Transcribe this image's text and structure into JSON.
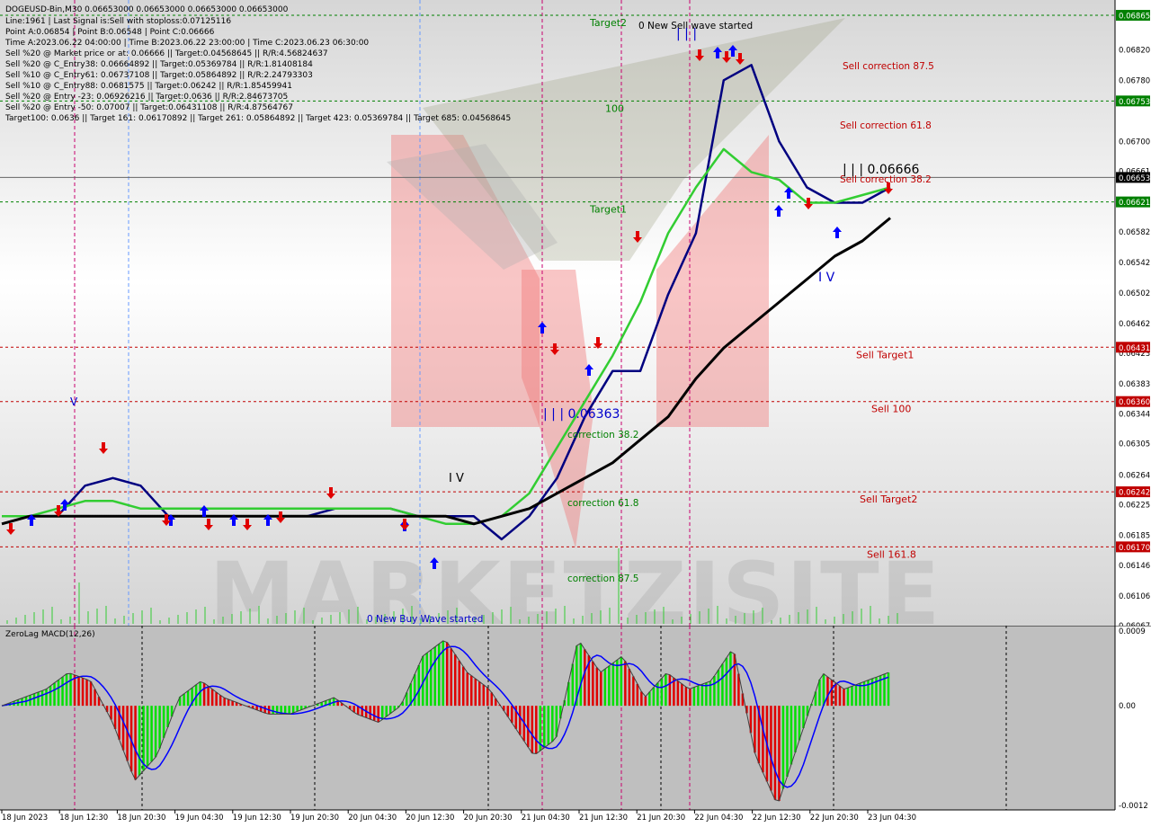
{
  "header": {
    "symbol_line": "DOGEUSD-Bin,M30  0.06653000 0.06653000 0.06653000 0.06653000",
    "info_lines": [
      "Line:1961 | Last Signal is:Sell with stoploss:0.07125116",
      "Point A:0.06854 | Point B:0.06548 | Point C:0.06666",
      "Time A:2023.06.22 04:00:00 | Time B:2023.06.22 23:00:00 | Time C:2023.06.23 06:30:00",
      "Sell %20 @ Market price or at: 0.06666 || Target:0.04568645 || R/R:4.56824637",
      "Sell %20 @ C_Entry38: 0.06664892 || Target:0.05369784 || R/R:1.81408184",
      "Sell %10 @ C_Entry61: 0.06737108 || Target:0.05864892 || R/R:2.24793303",
      "Sell %10 @ C_Entry88: 0.0681575 || Target:0.06242 || R/R:1.85459941",
      "Sell %20 @ Entry -23: 0.06926216 || Target:0.0636 || R/R:2.84673705",
      "Sell %20 @ Entry -50: 0.07007 || Target:0.06431108 || R/R:4.87564767",
      "Target100: 0.0636 || Target 161: 0.06170892 || Target 261: 0.05864892 || Target 423: 0.05369784 || Target 685: 0.04568645"
    ]
  },
  "colors": {
    "target_level": "#008000",
    "sell_level": "#c00000",
    "fast_ma": "#000080",
    "mid_ma": "#32cd32",
    "slow_ma": "#000000",
    "macd_up": "#00e000",
    "macd_down": "#e00000",
    "signal_line": "#0000ff",
    "buy_arrow": "#0000ff",
    "sell_arrow": "#e00000",
    "current_price": "#000000",
    "cycle_line": "#c8006e"
  },
  "price_axis": {
    "ticks": [
      "0.06820",
      "0.06780",
      "0.06700",
      "0.06661",
      "0.06621",
      "0.06582",
      "0.06542",
      "0.06502",
      "0.06462",
      "0.06423",
      "0.06383",
      "0.06344",
      "0.06305",
      "0.06264",
      "0.06225",
      "0.06185",
      "0.06146",
      "0.06106",
      "0.06067"
    ],
    "highlight_labels": [
      {
        "value": 0.06865,
        "text": "0.06865",
        "color": "#008000"
      },
      {
        "value": 0.06753,
        "text": "0.06753",
        "color": "#008000"
      },
      {
        "value": 0.06621,
        "text": "0.06621",
        "color": "#008000"
      },
      {
        "value": 0.06653,
        "text": "0.06653",
        "color": "#000000"
      },
      {
        "value": 0.06431,
        "text": "0.06431",
        "color": "#c00000"
      },
      {
        "value": 0.0636,
        "text": "0.06360",
        "color": "#c00000"
      },
      {
        "value": 0.06242,
        "text": "0.06242",
        "color": "#c00000"
      },
      {
        "value": 0.0617,
        "text": "0.06170",
        "color": "#c00000"
      }
    ]
  },
  "time_axis": {
    "labels": [
      "18 Jun 2023",
      "18 Jun 12:30",
      "18 Jun 20:30",
      "19 Jun 04:30",
      "19 Jun 12:30",
      "19 Jun 20:30",
      "20 Jun 04:30",
      "20 Jun 12:30",
      "20 Jun 20:30",
      "21 Jun 04:30",
      "21 Jun 12:30",
      "21 Jun 20:30",
      "22 Jun 04:30",
      "22 Jun 12:30",
      "22 Jun 20:30",
      "23 Jun 04:30"
    ]
  },
  "levels": [
    {
      "value": 0.06865,
      "label": "Target2",
      "label_color": "#008000"
    },
    {
      "value": 0.06753,
      "label": "100",
      "label_color": "#008000"
    },
    {
      "value": 0.06621,
      "label": "Target1",
      "label_color": "#008000"
    },
    {
      "value": 0.06431,
      "label": "Sell Target1",
      "label_color": "#c00000"
    },
    {
      "value": 0.0636,
      "label": "Sell 100",
      "label_color": "#c00000"
    },
    {
      "value": 0.06242,
      "label": "Sell Target2",
      "label_color": "#c00000"
    },
    {
      "value": 0.0617,
      "label": "Sell 161.8",
      "label_color": "#c00000"
    }
  ],
  "annotations": {
    "sell_wave": "0 New Sell wave started",
    "buy_wave": "0 New Buy Wave started",
    "sell_corrections": [
      "Sell correction 87.5",
      "Sell correction 61.8",
      "Sell correction 38.2"
    ],
    "buy_corrections": [
      "correction 38.2",
      "correction 61.8",
      "correction 87.5"
    ],
    "point_c_label": "| | | 0.06666",
    "point_b_label": "| | | 0.06363",
    "wave_marks": [
      "| | |",
      "I V",
      "I V",
      "V"
    ]
  },
  "watermark": "MARKETZISITE",
  "macd": {
    "title": "ZeroLag MACD(12,26)",
    "axis_labels": [
      "0.0009",
      "0.00",
      "-0.0012"
    ]
  },
  "chart_data": {
    "type": "line",
    "title": "DOGEUSD-Bin,M30",
    "y_axis_range": [
      0.06067,
      0.06885
    ],
    "current_price": 0.06653,
    "series": [
      {
        "values": [
          0.0621,
          0.0621,
          0.0621,
          0.0625,
          0.0626,
          0.0625,
          0.0621,
          0.0621,
          0.0621,
          0.0621,
          0.0621,
          0.0621,
          0.0622,
          0.0622,
          0.0622,
          0.0621,
          0.0621,
          0.0621,
          0.0618,
          0.0621,
          0.0626,
          0.0634,
          0.064,
          0.064,
          0.065,
          0.0658,
          0.0678,
          0.068,
          0.067,
          0.0664,
          0.0662,
          0.0662,
          0.0664
        ]
      },
      {
        "values": [
          0.0621,
          0.0621,
          0.0622,
          0.0623,
          0.0623,
          0.0622,
          0.0622,
          0.0622,
          0.0622,
          0.0622,
          0.0622,
          0.0622,
          0.0622,
          0.0622,
          0.0622,
          0.0621,
          0.062,
          0.062,
          0.0621,
          0.0624,
          0.063,
          0.0636,
          0.0642,
          0.0649,
          0.0658,
          0.0664,
          0.0669,
          0.0666,
          0.0665,
          0.0662,
          0.0662,
          0.0663,
          0.0664
        ]
      },
      {
        "values": [
          0.062,
          0.0621,
          0.0621,
          0.0621,
          0.0621,
          0.0621,
          0.0621,
          0.0621,
          0.0621,
          0.0621,
          0.0621,
          0.0621,
          0.0621,
          0.0621,
          0.0621,
          0.0621,
          0.0621,
          0.062,
          0.0621,
          0.0622,
          0.0624,
          0.0626,
          0.0628,
          0.0631,
          0.0634,
          0.0639,
          0.0643,
          0.0646,
          0.0649,
          0.0652,
          0.0655,
          0.0657,
          0.066
        ]
      }
    ],
    "macd_range": [
      -0.0012,
      0.0009
    ],
    "macd_hist": [
      0.0,
      0.0001,
      0.0002,
      0.0004,
      0.0003,
      -0.0002,
      -0.0009,
      -0.0006,
      0.0001,
      0.0003,
      0.0001,
      0.0,
      -0.0001,
      -0.0001,
      0.0,
      0.0001,
      -0.0001,
      -0.0002,
      0.0,
      0.0006,
      0.0008,
      0.0004,
      0.0002,
      -0.0002,
      -0.0006,
      -0.0004,
      0.0008,
      0.0004,
      0.0006,
      0.0001,
      0.0004,
      0.0002,
      0.0003,
      0.0007,
      -0.0006,
      -0.0012,
      -0.0004,
      0.0004,
      0.0002,
      0.0003,
      0.0004
    ]
  }
}
